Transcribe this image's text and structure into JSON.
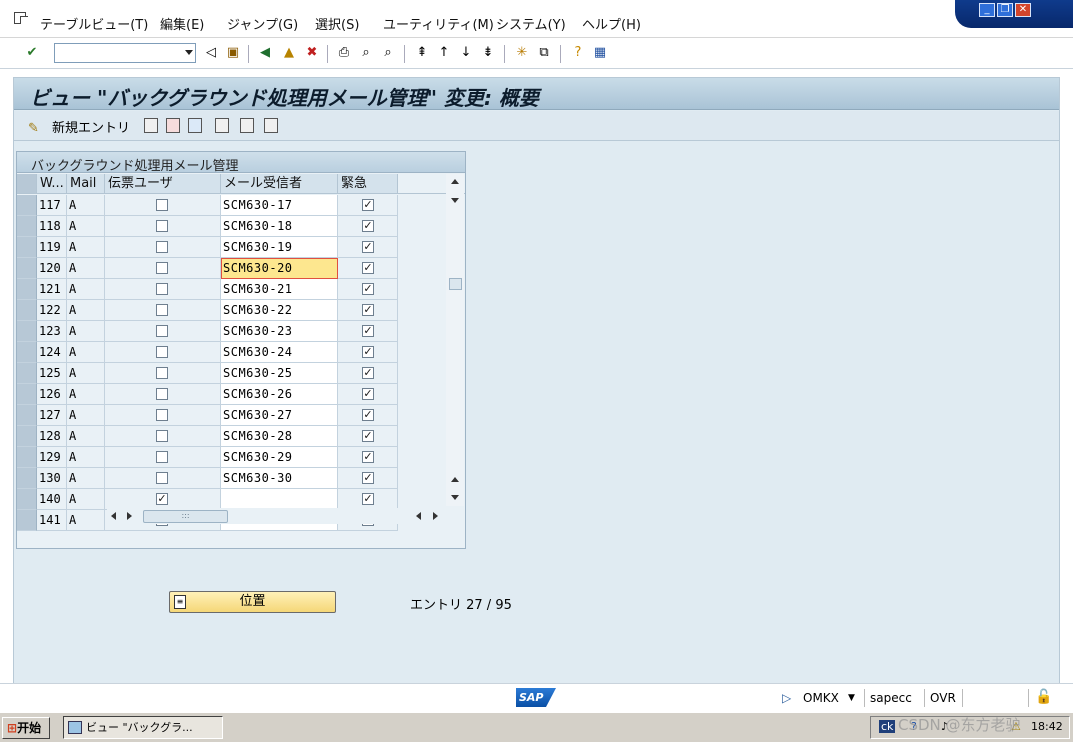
{
  "menu": {
    "items": [
      "テーブルビュー(T)",
      "編集(E)",
      "ジャンプ(G)",
      "選択(S)",
      "ユーティリティ(M)",
      "システム(Y)",
      "ヘルプ(H)"
    ]
  },
  "window": {
    "minimize": "_",
    "restore": "❐",
    "close": "✕"
  },
  "toolbar": {
    "command_value": "",
    "icons": [
      "enter-icon",
      "save-icon",
      "back-icon",
      "exit-icon",
      "cancel-icon",
      "print-icon",
      "find-icon",
      "find-next-icon",
      "first-page-icon",
      "previous-page-icon",
      "next-page-icon",
      "last-page-icon",
      "create-session-icon",
      "shortcut-icon",
      "help-icon",
      "layout-icon"
    ]
  },
  "title": "ビュー \"バックグラウンド処理用メール管理\" 変更: 概要",
  "app_toolbar": {
    "new_entry": "新規エントリ"
  },
  "table": {
    "title": "バックグラウンド処理用メール管理",
    "columns": [
      "W...",
      "Mail",
      "伝票ユーザ",
      "メール受信者",
      "緊急"
    ],
    "rows": [
      {
        "w": "117",
        "mail": "A",
        "user": false,
        "recipient": "SCM630-17",
        "urgent": true
      },
      {
        "w": "118",
        "mail": "A",
        "user": false,
        "recipient": "SCM630-18",
        "urgent": true
      },
      {
        "w": "119",
        "mail": "A",
        "user": false,
        "recipient": "SCM630-19",
        "urgent": true
      },
      {
        "w": "120",
        "mail": "A",
        "user": false,
        "recipient": "SCM630-20",
        "urgent": true
      },
      {
        "w": "121",
        "mail": "A",
        "user": false,
        "recipient": "SCM630-21",
        "urgent": true
      },
      {
        "w": "122",
        "mail": "A",
        "user": false,
        "recipient": "SCM630-22",
        "urgent": true
      },
      {
        "w": "123",
        "mail": "A",
        "user": false,
        "recipient": "SCM630-23",
        "urgent": true
      },
      {
        "w": "124",
        "mail": "A",
        "user": false,
        "recipient": "SCM630-24",
        "urgent": true
      },
      {
        "w": "125",
        "mail": "A",
        "user": false,
        "recipient": "SCM630-25",
        "urgent": true
      },
      {
        "w": "126",
        "mail": "A",
        "user": false,
        "recipient": "SCM630-26",
        "urgent": true
      },
      {
        "w": "127",
        "mail": "A",
        "user": false,
        "recipient": "SCM630-27",
        "urgent": true
      },
      {
        "w": "128",
        "mail": "A",
        "user": false,
        "recipient": "SCM630-28",
        "urgent": true
      },
      {
        "w": "129",
        "mail": "A",
        "user": false,
        "recipient": "SCM630-29",
        "urgent": true
      },
      {
        "w": "130",
        "mail": "A",
        "user": false,
        "recipient": "SCM630-30",
        "urgent": true
      },
      {
        "w": "140",
        "mail": "A",
        "user": true,
        "recipient": "",
        "urgent": true
      },
      {
        "w": "141",
        "mail": "A",
        "user": true,
        "recipient": "",
        "urgent": true
      }
    ],
    "focused_row": 3,
    "scroll_thumb_label": ":::"
  },
  "position_button": "位置",
  "entry_count": "エントリ 27 / 95",
  "status": {
    "logo": "SAP",
    "transaction": "OMKX",
    "server": "sapecc",
    "mode": "OVR"
  },
  "taskbar": {
    "start": "开始",
    "task": "ビュー \"バックグラ...",
    "tray_time": "18:42"
  },
  "watermark": "CSDN @东方老驴"
}
